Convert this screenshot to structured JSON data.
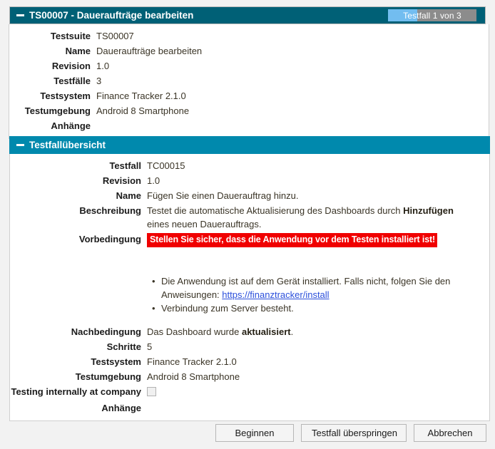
{
  "suite_panel": {
    "title": "TS00007 - Daueraufträge bearbeiten",
    "collapse_icon": "minus-icon",
    "progress": {
      "label": "Testfall 1 von 3",
      "current": 1,
      "total": 3,
      "fill_color": "#72bdf0",
      "track_color": "#8c8c8c"
    },
    "fields": [
      {
        "label": "Testsuite",
        "value": "TS00007"
      },
      {
        "label": "Name",
        "value": "Daueraufträge bearbeiten"
      },
      {
        "label": "Revision",
        "value": "1.0"
      },
      {
        "label": "Testfälle",
        "value": "3"
      },
      {
        "label": "Testsystem",
        "value": "Finance Tracker 2.1.0"
      },
      {
        "label": "Testumgebung",
        "value": "Android 8 Smartphone"
      },
      {
        "label": "Anhänge",
        "value": ""
      }
    ]
  },
  "case_panel": {
    "title": "Testfallübersicht",
    "collapse_icon": "minus-icon",
    "labels": {
      "testfall": "Testfall",
      "revision": "Revision",
      "name": "Name",
      "beschreibung": "Beschreibung",
      "vorbedingung": "Vorbedingung",
      "nachbedingung": "Nachbedingung",
      "schritte": "Schritte",
      "testsystem": "Testsystem",
      "testumgebung": "Testumgebung",
      "testing_internally": "Testing internally at company",
      "anhaenge": "Anhänge"
    },
    "values": {
      "testfall": "TC00015",
      "revision": "1.0",
      "name": "Fügen Sie einen Dauerauftrag hinzu.",
      "beschreibung_part1": "Testet die automatische Aktualisierung des Dashboards durch ",
      "beschreibung_bold": "Hinzufügen",
      "beschreibung_part2": " eines neuen Dauerauftrags.",
      "vorbedingung_warning": "Stellen Sie sicher, dass die Anwendung vor dem Testen installiert ist!",
      "bullet1_part1": "Die Anwendung ist auf dem Gerät installiert. Falls nicht, folgen Sie den Anweisungen: ",
      "bullet1_link": "https://finanztracker/install",
      "bullet2": "Verbindung zum Server besteht.",
      "nachbedingung_part1": "Das Dashboard wurde ",
      "nachbedingung_bold": "aktualisiert",
      "nachbedingung_part2": ".",
      "schritte": "5",
      "testsystem": "Finance Tracker 2.1.0",
      "testumgebung": "Android 8 Smartphone",
      "testing_internally_checked": false,
      "anhaenge": ""
    }
  },
  "footer": {
    "begin_label": "Beginnen",
    "skip_label": "Testfall überspringen",
    "cancel_label": "Abbrechen"
  },
  "colors": {
    "header_dark": "#006076",
    "header_light": "#0089ad",
    "warning_red": "#f00000",
    "link_blue": "#2b4fdb",
    "page_bg": "#f2f2f2"
  }
}
